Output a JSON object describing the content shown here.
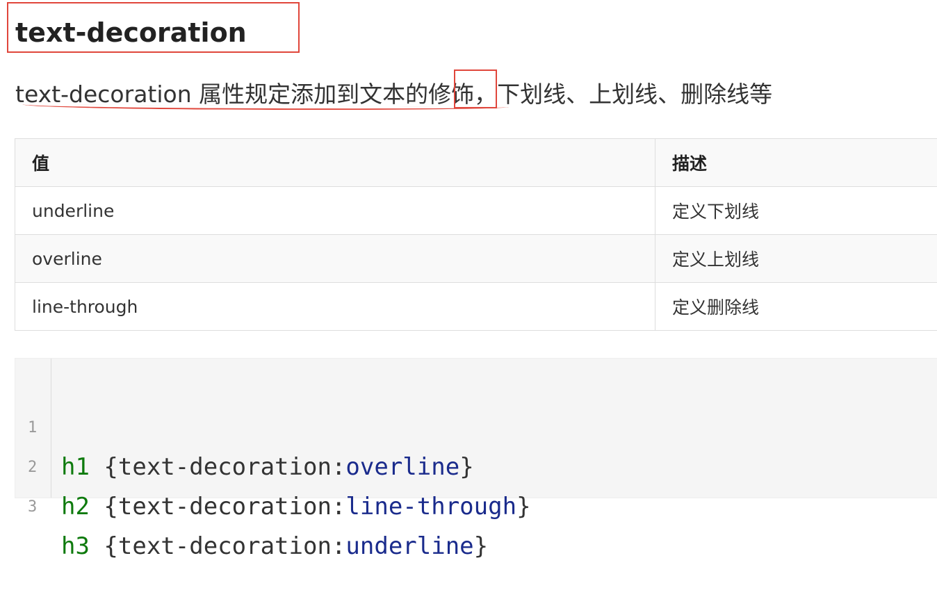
{
  "heading": "text-decoration",
  "description": "text-decoration 属性规定添加到文本的修饰，下划线、上划线、删除线等",
  "table": {
    "headers": [
      "值",
      "描述"
    ],
    "rows": [
      [
        "underline",
        "定义下划线"
      ],
      [
        "overline",
        "定义上划线"
      ],
      [
        "line-through",
        "定义删除线"
      ]
    ]
  },
  "code": {
    "lines": [
      {
        "num": "1",
        "selector": "h1",
        "open": " {text-decoration:",
        "value": "overline",
        "close": "}"
      },
      {
        "num": "2",
        "selector": "h2",
        "open": " {text-decoration:",
        "value": "line-through",
        "close": "}"
      },
      {
        "num": "3",
        "selector": "h3",
        "open": " {text-decoration:",
        "value": "underline",
        "close": "}"
      }
    ]
  },
  "colors": {
    "annotation": "#e0463b",
    "selector": "#0e7a0d",
    "value": "#1a2b8c"
  }
}
